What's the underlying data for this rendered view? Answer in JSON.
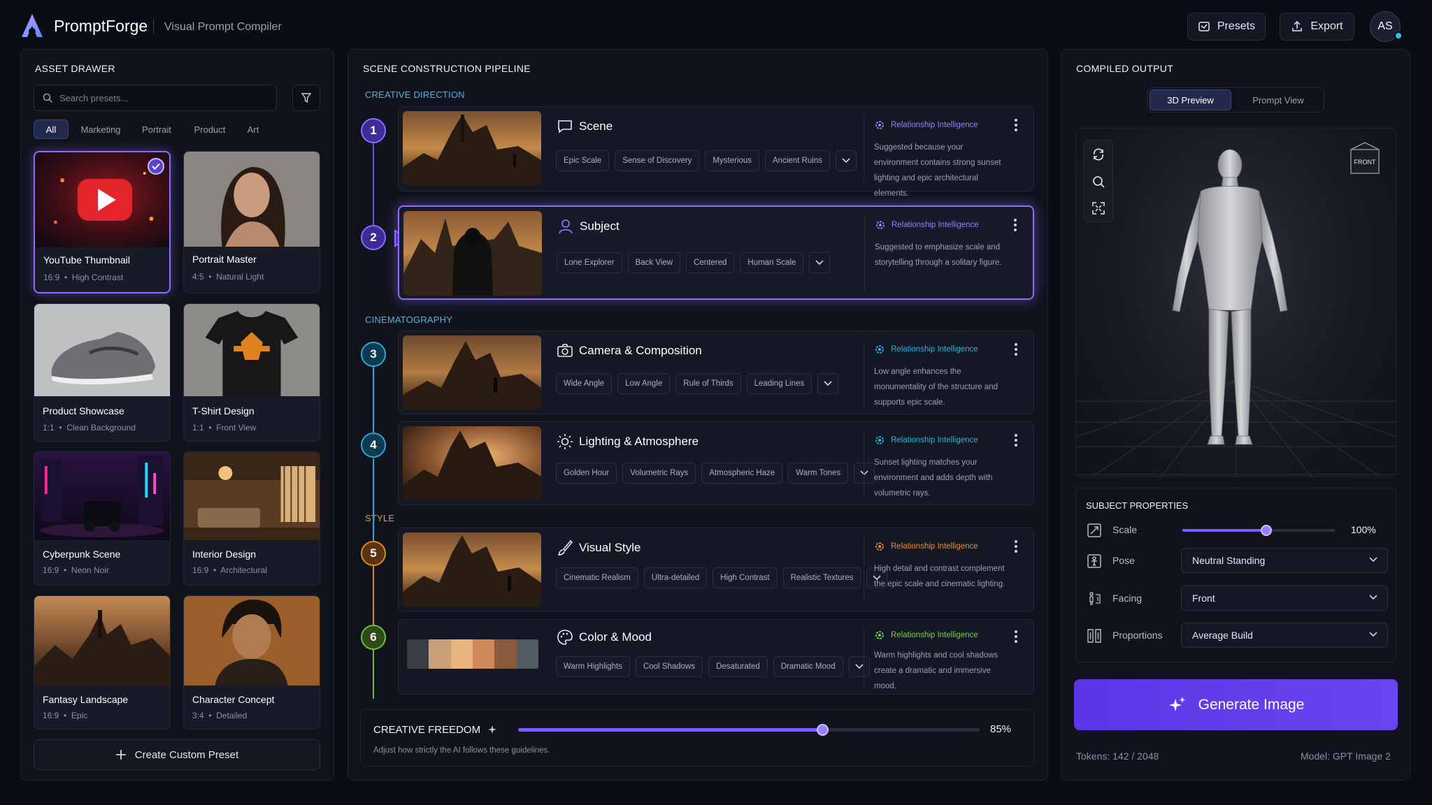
{
  "header": {
    "app_name": "PromptForge",
    "subtitle": "Visual Prompt Compiler",
    "presets_label": "Presets",
    "export_label": "Export",
    "avatar_initials": "AS"
  },
  "drawer": {
    "title": "ASSET DRAWER",
    "search_placeholder": "Search presets...",
    "filters": [
      "All",
      "Marketing",
      "Portrait",
      "Product",
      "Art"
    ],
    "cards": [
      {
        "title": "YouTube Thumbnail",
        "ratio": "16:9",
        "detail": "High Contrast"
      },
      {
        "title": "Portrait Master",
        "ratio": "4:5",
        "detail": "Natural Light"
      },
      {
        "title": "Product Showcase",
        "ratio": "1:1",
        "detail": "Clean Background"
      },
      {
        "title": "T-Shirt Design",
        "ratio": "1:1",
        "detail": "Front View"
      },
      {
        "title": "Cyberpunk Scene",
        "ratio": "16:9",
        "detail": "Neon Noir"
      },
      {
        "title": "Interior Design",
        "ratio": "16:9",
        "detail": "Architectural"
      },
      {
        "title": "Fantasy Landscape",
        "ratio": "16:9",
        "detail": "Epic"
      },
      {
        "title": "Character Concept",
        "ratio": "3:4",
        "detail": "Detailed"
      }
    ],
    "create_label": "Create Custom Preset"
  },
  "pipeline": {
    "title": "SCENE CONSTRUCTION PIPELINE",
    "sections": {
      "creative": "CREATIVE DIRECTION",
      "cinema": "CINEMATOGRAPHY",
      "style": "STYLE"
    },
    "ri_label": "Relationship Intelligence",
    "steps": [
      {
        "num": "1",
        "title": "Scene",
        "tags": [
          "Epic Scale",
          "Sense of Discovery",
          "Mysterious",
          "Ancient Ruins"
        ],
        "reason": "Suggested because your environment contains strong sunset lighting and epic architectural elements."
      },
      {
        "num": "2",
        "title": "Subject",
        "tags": [
          "Lone Explorer",
          "Back View",
          "Centered",
          "Human Scale"
        ],
        "reason": "Suggested to emphasize scale and storytelling through a solitary figure."
      },
      {
        "num": "3",
        "title": "Camera & Composition",
        "tags": [
          "Wide Angle",
          "Low Angle",
          "Rule of Thirds",
          "Leading Lines"
        ],
        "reason": "Low angle enhances the monumentality of the structure and supports epic scale."
      },
      {
        "num": "4",
        "title": "Lighting & Atmosphere",
        "tags": [
          "Golden Hour",
          "Volumetric Rays",
          "Atmospheric Haze",
          "Warm Tones"
        ],
        "reason": "Sunset lighting matches your environment and adds depth with volumetric rays."
      },
      {
        "num": "5",
        "title": "Visual Style",
        "tags": [
          "Cinematic Realism",
          "Ultra-detailed",
          "High Contrast",
          "Realistic Textures"
        ],
        "reason": "High detail and contrast complement the epic scale and cinematic lighting."
      },
      {
        "num": "6",
        "title": "Color & Mood",
        "tags": [
          "Warm Highlights",
          "Cool Shadows",
          "Desaturated",
          "Dramatic Mood"
        ],
        "reason": "Warm highlights and cool shadows create a dramatic and immersive mood."
      }
    ],
    "palette": [
      "#3a3d44",
      "#caa079",
      "#e8b37c",
      "#d2875a",
      "#8a5a3c",
      "#545a64"
    ],
    "creative_freedom": {
      "label": "CREATIVE FREEDOM",
      "value": 85,
      "value_label": "85%",
      "hint": "Adjust how strictly the AI follows these guidelines."
    }
  },
  "output": {
    "title": "COMPILED OUTPUT",
    "tabs": [
      "3D Preview",
      "Prompt View"
    ],
    "cube_label": "FRONT",
    "props_title": "SUBJECT PROPERTIES",
    "scale_label": "Scale",
    "scale_value": 100,
    "scale_value_label": "100%",
    "scale_fill": 0.55,
    "pose_label": "Pose",
    "pose_value": "Neutral Standing",
    "facing_label": "Facing",
    "facing_value": "Front",
    "proportions_label": "Proportions",
    "proportions_value": "Average Build",
    "generate_label": "Generate Image",
    "tokens": "Tokens: 142 / 2048",
    "model": "Model: GPT Image 2"
  },
  "colors": {
    "accent": "#7b5cff",
    "step1": "#7b5cff",
    "step3": "#2aa8d6",
    "step5": "#e08a1e",
    "step6": "#6cbf3a",
    "sect_blue": "#4fb3e8",
    "sect_style": "#e89a2a"
  }
}
